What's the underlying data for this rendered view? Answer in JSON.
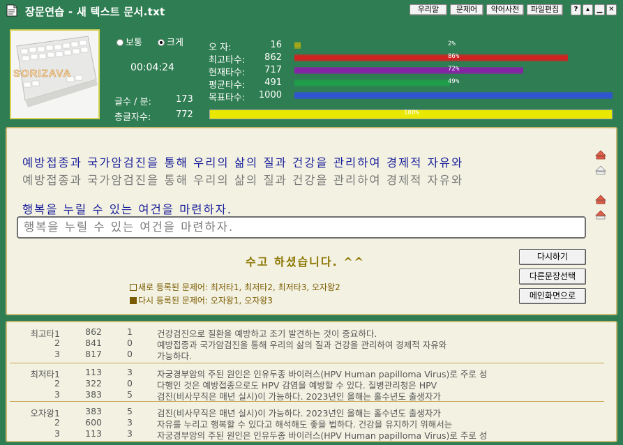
{
  "window": {
    "title": "장문연습 - 새 텍스트 문서.txt"
  },
  "toolbar": {
    "btn1": "우리말",
    "btn2": "문제어",
    "btn3": "약어사전",
    "btn4": "파일편집",
    "help": "?"
  },
  "photo": {
    "logo_text": "SORIZAVA"
  },
  "mode": {
    "normal": "보통",
    "large": "크게",
    "selected": "large"
  },
  "timer": "00:04:24",
  "speed": {
    "label": "글수 / 분:",
    "value": "173"
  },
  "total": {
    "label": "총글자수:",
    "value": "772"
  },
  "stats": [
    {
      "label": "오    자:",
      "value": "16",
      "pct": 2,
      "pct_text": "2%",
      "color": "#a8a818"
    },
    {
      "label": "최고타수:",
      "value": "862",
      "pct": 86,
      "pct_text": "86%",
      "color": "#d81f1f"
    },
    {
      "label": "현재타수:",
      "value": "717",
      "pct": 72,
      "pct_text": "72%",
      "color": "#8a1fa8"
    },
    {
      "label": "평균타수:",
      "value": "491",
      "pct": 49,
      "pct_text": "49%",
      "color": "#1fa04a"
    },
    {
      "label": "목표타수:",
      "value": "1000",
      "pct": 100,
      "pct_text": "",
      "color": "#2f52d8"
    }
  ],
  "progress": {
    "pct": 100,
    "pct_text": "100%",
    "color": "#e8e800"
  },
  "practice": {
    "line1_source": "예방접종과 국가암검진을 통해 우리의 삶의 질과 건강을 관리하여 경제적 자유와",
    "line1_typed": "예방접종과 국가암검진을 통해 우리의 삶의 질과 건강을 관리하여 경제적 자유와",
    "line2_source": "행복을 누릴 수 있는 여건을 마련하자.",
    "line2_input": "행복을 누릴 수 있는 여건을 마련하자."
  },
  "result": {
    "message": "수고 하셨습니다. ^^",
    "new_words": "새로 등록된 문제어: 최저타1, 최저타2, 최저타3, 오자왕2",
    "again_words": "다시 등록된 문제어: 오자왕1, 오자왕3"
  },
  "buttons": {
    "retry": "다시하기",
    "other": "다른문장선택",
    "main": "메인화면으로"
  },
  "records": [
    {
      "cat": "최고타1",
      "score": "862",
      "err": "1",
      "text": "건강검진으로 질환을 예방하고 조기 발견하는 것이 중요하다."
    },
    {
      "cat": "2",
      "score": "841",
      "err": "0",
      "text": "예방접종과 국가암검진을 통해 우리의 삶의 질과 건강을 관리하여 경제적 자유와"
    },
    {
      "cat": "3",
      "score": "817",
      "err": "0",
      "text": "가능하다."
    },
    {
      "cat": "최저타1",
      "score": "113",
      "err": "3",
      "text": "자궁경부암의 주된 원인은 인유두종 바이러스(HPV Human papilloma Virus)로 주로 성"
    },
    {
      "cat": "2",
      "score": "322",
      "err": "0",
      "text": "다행인 것은 예방접종으로도 HPV 감염을 예방할 수 있다. 질병관리청은 HPV"
    },
    {
      "cat": "3",
      "score": "383",
      "err": "5",
      "text": "검진(비사무직은 매년 실시)이 가능하다. 2023년인 올해는 홀수년도 출생자가"
    },
    {
      "cat": "오자왕1",
      "score": "383",
      "err": "5",
      "text": "검진(비사무직은 매년 실시)이 가능하다. 2023년인 올해는 홀수년도 출생자가"
    },
    {
      "cat": "2",
      "score": "600",
      "err": "3",
      "text": "자유를 누리고 행복할 수 있다고 해석해도 좋을 법하다. 건강을 유지하기 위해서는"
    },
    {
      "cat": "3",
      "score": "113",
      "err": "3",
      "text": "자궁경부암의 주된 원인은 인유두종 바이러스(HPV Human papilloma Virus)로 주로 성"
    }
  ]
}
